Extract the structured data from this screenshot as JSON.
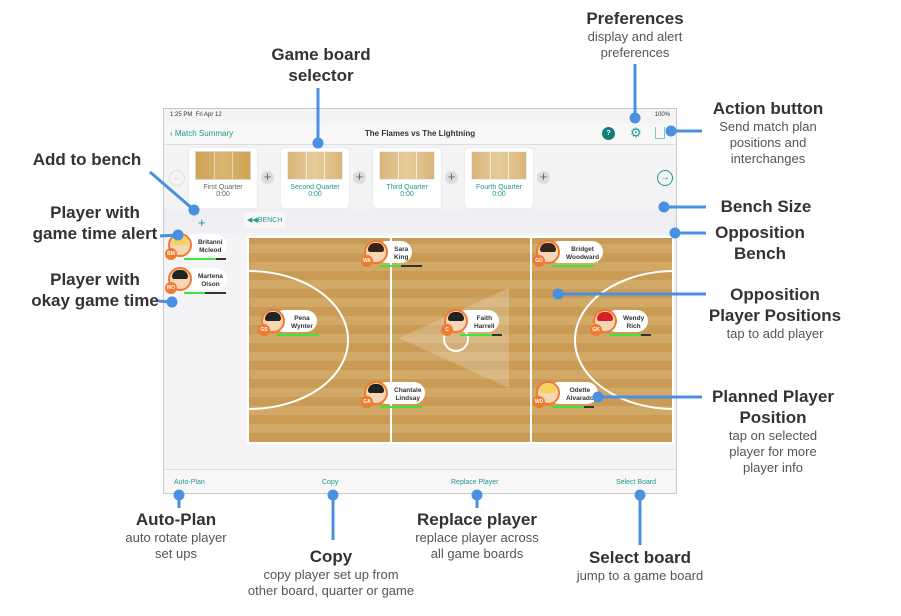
{
  "status": {
    "time": "1:25 PM",
    "date": "Fri Apr 12",
    "battery": "100%"
  },
  "nav": {
    "back": "Match Summary",
    "title": "The Flames vs The Lightning",
    "help": "?"
  },
  "boards": [
    {
      "label": "First Quarter",
      "time": "0:00",
      "selected": true
    },
    {
      "label": "Second Quarter",
      "time": "0:00"
    },
    {
      "label": "Third Quarter",
      "time": "0:00"
    },
    {
      "label": "Fourth Quarter",
      "time": "0:00"
    }
  ],
  "bench_button": "BENCH",
  "add_bench": "+",
  "bench": [
    {
      "name": "Britanni Mcleod",
      "pos": "BM",
      "hair": "#f5d35a",
      "fill": 0.75
    },
    {
      "name": "Martena Olson",
      "pos": "MO",
      "hair": "#222",
      "fill": 0.5
    }
  ],
  "court": [
    {
      "name": "Sara King",
      "pos": "WA",
      "hair": "#3a2418",
      "fill": 0.5
    },
    {
      "name": "Bridget Woodward",
      "pos": "GD",
      "hair": "#3a2418",
      "fill": 1.0
    },
    {
      "name": "Pena Wynter",
      "pos": "GS",
      "hair": "#222",
      "fill": 1.0
    },
    {
      "name": "Faith Harrell",
      "pos": "C",
      "hair": "#222",
      "fill": 0.75
    },
    {
      "name": "Wendy Rich",
      "pos": "GK",
      "hair": "#d42020",
      "fill": 0.75
    },
    {
      "name": "Chantale Lindsay",
      "pos": "GA",
      "hair": "#222",
      "fill": 1.0
    },
    {
      "name": "Odette Alvarado",
      "pos": "WD",
      "hair": "#f5d35a",
      "fill": 0.75
    }
  ],
  "toolbar": {
    "autoplan": "Auto-Plan",
    "copy": "Copy",
    "replace": "Replace Player",
    "select": "Select Board"
  },
  "annotations": {
    "preferences": {
      "title": "Preferences",
      "sub1": "display and alert",
      "sub2": "preferences"
    },
    "selector": {
      "t1": "Game board",
      "t2": "selector"
    },
    "action": {
      "title": "Action button",
      "sub1": "Send match plan",
      "sub2": "positions and",
      "sub3": "interchanges"
    },
    "add_bench": {
      "title": "Add to bench"
    },
    "alert": {
      "t1": "Player with",
      "t2": "game time alert"
    },
    "okay": {
      "t1": "Player with",
      "t2": "okay game time"
    },
    "bench_size": {
      "title": "Bench Size"
    },
    "opp_bench": {
      "t1": "Opposition",
      "t2": "Bench"
    },
    "opp_pos": {
      "t1": "Opposition",
      "t2": "Player Positions",
      "sub": "tap to add player"
    },
    "planned": {
      "t1": "Planned Player",
      "t2": "Position",
      "sub1": "tap on selected",
      "sub2": "player for more",
      "sub3": "player info"
    },
    "autoplan": {
      "title": "Auto-Plan",
      "sub1": "auto rotate player",
      "sub2": "set ups"
    },
    "copy": {
      "title": "Copy",
      "sub1": "copy player set up from",
      "sub2": "other board, quarter or game"
    },
    "replace": {
      "title": "Replace player",
      "sub1": "replace player across",
      "sub2": "all game boards"
    },
    "select": {
      "title": "Select board",
      "sub1": "jump to a game board"
    }
  },
  "colors": {
    "accent": "#1b9a8e",
    "annotation": "#4a90e2",
    "badge": "#f07a30"
  }
}
